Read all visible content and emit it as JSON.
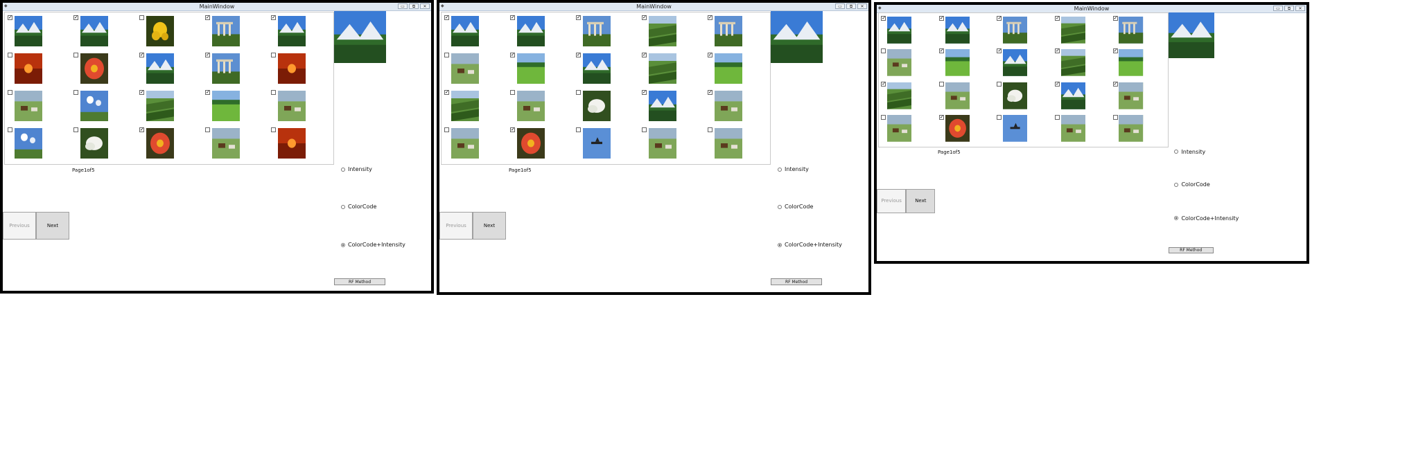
{
  "windows": [
    {
      "title": "MainWindow",
      "page_label": "Page1of5",
      "prev_label": "Previous",
      "next_label": "Next",
      "rf_label": "RF Method",
      "radio_options": [
        "Intensity",
        "ColorCode",
        "ColorCode+Intensity"
      ],
      "selected_radio": 2,
      "grid": [
        [
          {
            "checked": true,
            "kind": "mountain"
          },
          {
            "checked": true,
            "kind": "mountain"
          },
          {
            "checked": false,
            "kind": "flower"
          },
          {
            "checked": true,
            "kind": "ruins"
          },
          {
            "checked": true,
            "kind": "mountain"
          }
        ],
        [
          {
            "checked": false,
            "kind": "sunset"
          },
          {
            "checked": false,
            "kind": "redflower"
          },
          {
            "checked": true,
            "kind": "mountain"
          },
          {
            "checked": true,
            "kind": "ruins"
          },
          {
            "checked": false,
            "kind": "sunset"
          }
        ],
        [
          {
            "checked": false,
            "kind": "horses"
          },
          {
            "checked": false,
            "kind": "sky"
          },
          {
            "checked": true,
            "kind": "hills"
          },
          {
            "checked": true,
            "kind": "field"
          },
          {
            "checked": false,
            "kind": "horses"
          }
        ],
        [
          {
            "checked": false,
            "kind": "sky"
          },
          {
            "checked": false,
            "kind": "lily"
          },
          {
            "checked": true,
            "kind": "redflower"
          },
          {
            "checked": false,
            "kind": "horses"
          },
          {
            "checked": false,
            "kind": "sunset"
          }
        ]
      ]
    },
    {
      "title": "MainWindow",
      "page_label": "Page1of5",
      "prev_label": "Previous",
      "next_label": "Next",
      "rf_label": "RF Method",
      "radio_options": [
        "Intensity",
        "ColorCode",
        "ColorCode+Intensity"
      ],
      "selected_radio": 2,
      "grid": [
        [
          {
            "checked": true,
            "kind": "mountain"
          },
          {
            "checked": true,
            "kind": "mountain"
          },
          {
            "checked": true,
            "kind": "ruins"
          },
          {
            "checked": true,
            "kind": "hills"
          },
          {
            "checked": true,
            "kind": "ruins"
          }
        ],
        [
          {
            "checked": false,
            "kind": "horses"
          },
          {
            "checked": true,
            "kind": "field"
          },
          {
            "checked": true,
            "kind": "mountain"
          },
          {
            "checked": true,
            "kind": "hills"
          },
          {
            "checked": true,
            "kind": "field"
          }
        ],
        [
          {
            "checked": true,
            "kind": "hills"
          },
          {
            "checked": false,
            "kind": "horses"
          },
          {
            "checked": false,
            "kind": "lily"
          },
          {
            "checked": true,
            "kind": "mountain"
          },
          {
            "checked": true,
            "kind": "horses"
          }
        ],
        [
          {
            "checked": false,
            "kind": "horses"
          },
          {
            "checked": true,
            "kind": "redflower"
          },
          {
            "checked": false,
            "kind": "plane"
          },
          {
            "checked": false,
            "kind": "horses"
          },
          {
            "checked": false,
            "kind": "horses"
          }
        ]
      ]
    },
    {
      "title": "MainWindow",
      "page_label": "Page1of5",
      "prev_label": "Previous",
      "next_label": "Next",
      "rf_label": "RF Method",
      "radio_options": [
        "Intensity",
        "ColorCode",
        "ColorCode+Intensity"
      ],
      "selected_radio": 2,
      "grid": [
        [
          {
            "checked": true,
            "kind": "mountain"
          },
          {
            "checked": true,
            "kind": "mountain"
          },
          {
            "checked": true,
            "kind": "ruins"
          },
          {
            "checked": true,
            "kind": "hills"
          },
          {
            "checked": true,
            "kind": "ruins"
          }
        ],
        [
          {
            "checked": false,
            "kind": "horses"
          },
          {
            "checked": true,
            "kind": "field"
          },
          {
            "checked": true,
            "kind": "mountain"
          },
          {
            "checked": true,
            "kind": "hills"
          },
          {
            "checked": true,
            "kind": "field"
          }
        ],
        [
          {
            "checked": true,
            "kind": "hills"
          },
          {
            "checked": false,
            "kind": "horses"
          },
          {
            "checked": false,
            "kind": "lily"
          },
          {
            "checked": true,
            "kind": "mountain"
          },
          {
            "checked": true,
            "kind": "horses"
          }
        ],
        [
          {
            "checked": false,
            "kind": "horses"
          },
          {
            "checked": true,
            "kind": "redflower"
          },
          {
            "checked": false,
            "kind": "plane"
          },
          {
            "checked": false,
            "kind": "horses"
          },
          {
            "checked": false,
            "kind": "horses"
          }
        ]
      ]
    }
  ]
}
